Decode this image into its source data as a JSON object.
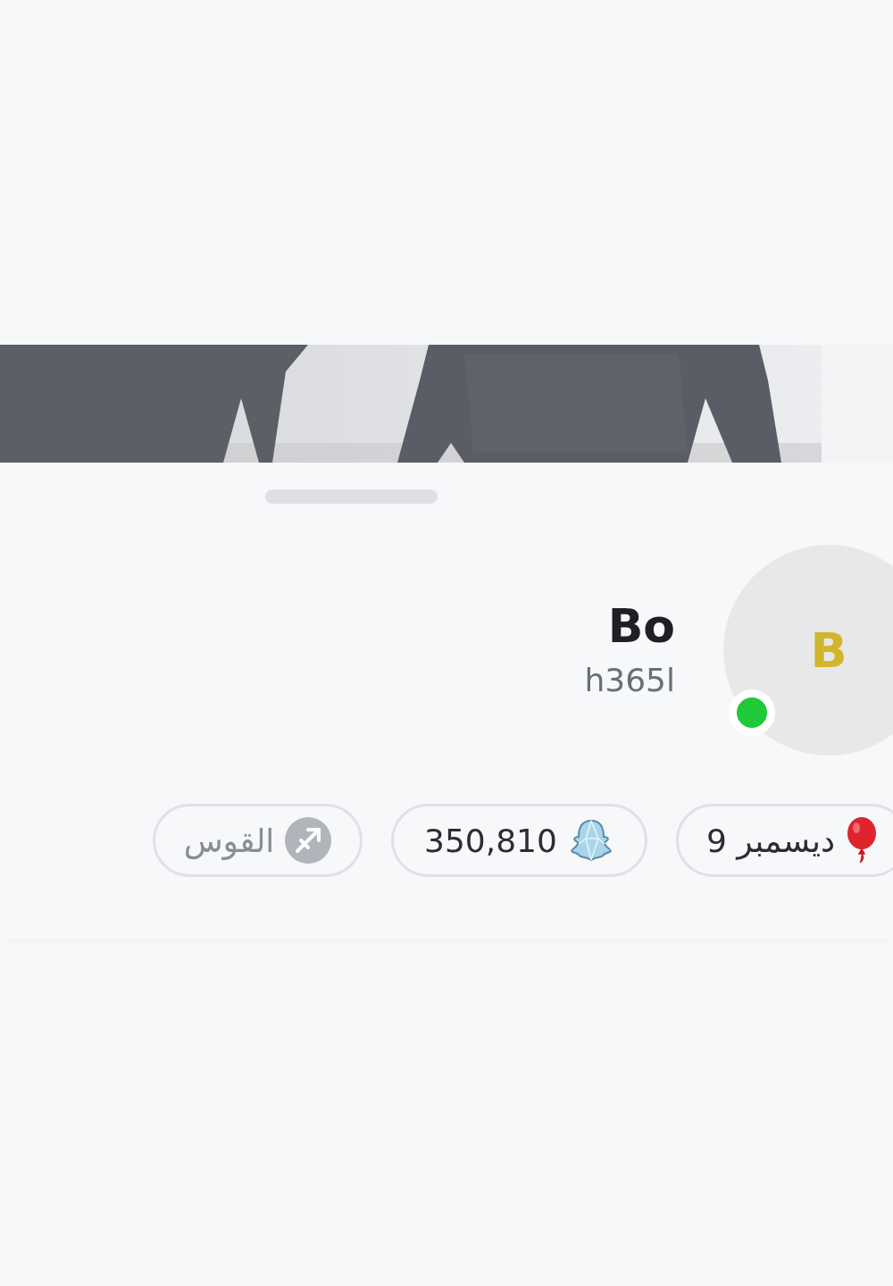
{
  "profile": {
    "initial": "B",
    "online": true,
    "display_name": "Bo",
    "username": "h365l"
  },
  "badges": [
    {
      "kind": "birthday",
      "label": "9 ديسمبر"
    },
    {
      "kind": "score",
      "label": "350,810"
    },
    {
      "kind": "zodiac",
      "label": "القوس"
    }
  ]
}
